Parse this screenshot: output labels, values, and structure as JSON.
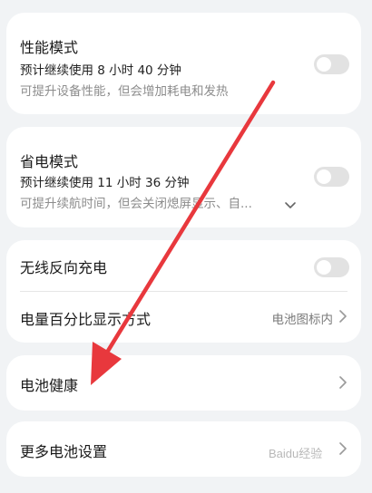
{
  "performance_mode": {
    "title": "性能模式",
    "estimate": "预计继续使用 8 小时 40 分钟",
    "description": "可提升设备性能，但会增加耗电和发热",
    "enabled": false
  },
  "power_save_mode": {
    "title": "省电模式",
    "estimate": "预计继续使用 11 小时 36 分钟",
    "description": "可提升续航时间，但会关闭熄屏显示、自...",
    "enabled": false
  },
  "reverse_charging": {
    "title": "无线反向充电",
    "enabled": false
  },
  "battery_percentage": {
    "title": "电量百分比显示方式",
    "value": "电池图标内"
  },
  "battery_health": {
    "title": "电池健康"
  },
  "more_settings": {
    "title": "更多电池设置"
  },
  "annotation": {
    "arrow_color": "#e8383d"
  },
  "icons": {
    "chevron": "chevron-right-icon",
    "expand": "chevron-down-icon"
  }
}
